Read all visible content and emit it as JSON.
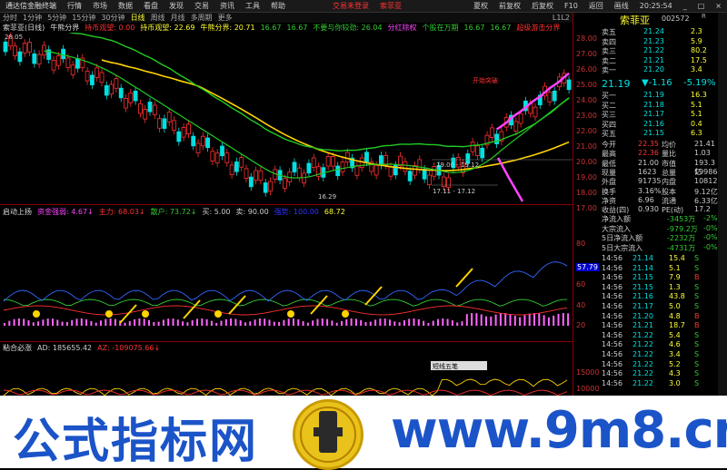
{
  "topbar": {
    "app_title": "通达信金融终端",
    "menu": [
      "行情",
      "市场",
      "数据",
      "看盘",
      "发现",
      "交易",
      "资讯",
      "工具",
      "帮助"
    ],
    "center_left": "交易未登录",
    "center_right": "索菲亚",
    "right_buttons": [
      "夏权",
      "前复权",
      "后复权",
      "F10",
      "返回",
      "画线"
    ],
    "time": "20:25:54",
    "window_controls": [
      "_",
      "□",
      "×"
    ]
  },
  "periodbar": {
    "items": [
      "分时",
      "1分钟",
      "5分钟",
      "15分钟",
      "30分钟",
      "日线",
      "周线",
      "月线",
      "多周期",
      "更多"
    ],
    "active": "日线",
    "right": "L1L2"
  },
  "chartinfo": {
    "stock": "索菲亚(日线)",
    "indicator": "牛熊分界",
    "line1": "持币观望: 0.00",
    "line2": "持币观望: 22.69",
    "line3": "牛熊分界: 20.71",
    "line4": "16.67",
    "line5": "16.67",
    "line6": "不要与你较劲: 26.04",
    "line7": "分红除权",
    "line8": "个股在万期",
    "line9": "16.67",
    "line10": "16.67",
    "line11": "超级游击分界"
  },
  "main_chart": {
    "high_label": "28.05",
    "low_label": "16.29",
    "range_label_1": "19.00 - 19.12",
    "range_label_2": "17.11 - 17.12",
    "marker_1": "开始突破",
    "y_ticks": [
      "28.00",
      "27.00",
      "26.00",
      "25.00",
      "24.00",
      "23.00",
      "22.00",
      "21.00",
      "20.00",
      "19.00",
      "18.00",
      "17.00"
    ]
  },
  "panel2": {
    "name": "启动上扬",
    "vals": [
      "资金强弱: 4.67↓",
      "主力: 68.03↓",
      "散户: 73.72↓",
      "买: 5.00",
      "卖: 90.00",
      "强势: 100.00",
      "68.72"
    ],
    "y_ticks": [
      "80",
      "60",
      "40",
      "20"
    ],
    "badge": "57.79",
    "marker_label": "启动"
  },
  "panel3": {
    "name": "粘合必涨",
    "vals": [
      "AD: 185655.42",
      "AZ: -109075.66↓"
    ],
    "y_ticks": [
      "15000",
      "10000",
      "5000"
    ],
    "popup": "短线五笔"
  },
  "quote": {
    "name": "索菲亚",
    "code": "002572",
    "code_suffix": "R",
    "price": "21.19",
    "change": "▼-1.16",
    "pct": "-5.19%",
    "asks": [
      {
        "label": "卖五",
        "price": "21.24",
        "vol": "2.3"
      },
      {
        "label": "卖四",
        "price": "21.23",
        "vol": "5.9"
      },
      {
        "label": "卖三",
        "price": "21.22",
        "vol": "80.2"
      },
      {
        "label": "卖二",
        "price": "21.21",
        "vol": "17.5"
      },
      {
        "label": "卖一",
        "price": "21.20",
        "vol": "3.4"
      }
    ],
    "bids": [
      {
        "label": "买一",
        "price": "21.19",
        "vol": "16.3"
      },
      {
        "label": "买二",
        "price": "21.18",
        "vol": "5.1"
      },
      {
        "label": "买三",
        "price": "21.17",
        "vol": "5.1"
      },
      {
        "label": "买四",
        "price": "21.16",
        "vol": "0.4"
      },
      {
        "label": "买五",
        "price": "21.15",
        "vol": "6.3"
      }
    ],
    "stats": [
      {
        "l": "今开",
        "v": "22.35",
        "l2": "均价",
        "v2": "21.41"
      },
      {
        "l": "最高",
        "v": "22.36",
        "l2": "量比",
        "v2": "1.03"
      },
      {
        "l": "最低",
        "v": "21.00",
        "l2": "市值",
        "v2": "193.3亿"
      },
      {
        "l": "现量",
        "v": "1623",
        "l2": "总量",
        "v2": "199864"
      },
      {
        "l": "外盘",
        "v": "91735",
        "l2": "内盘",
        "v2": "108129"
      },
      {
        "l": "换手",
        "v": "3.16%",
        "l2": "股本",
        "v2": "9.12亿"
      },
      {
        "l": "净资",
        "v": "6.96",
        "l2": "流通",
        "v2": "6.33亿"
      },
      {
        "l": "收益(四)",
        "v": "0.930",
        "l2": "PE(动)",
        "v2": "17.2"
      }
    ],
    "flows": [
      {
        "l": "净流入额",
        "v": "-3453万",
        "p": "-2%"
      },
      {
        "l": "大宗流入",
        "v": "-979.2万",
        "p": "-0%"
      },
      {
        "l": "5日净流入额",
        "v": "-2232万",
        "p": "-0%"
      },
      {
        "l": "5日大宗流入",
        "v": "-4731万",
        "p": "-0%"
      }
    ],
    "ticks": [
      {
        "t": "14:56",
        "p": "21.14",
        "v": "15.4",
        "s": "S"
      },
      {
        "t": "14:56",
        "p": "21.14",
        "v": "5.1",
        "s": "S"
      },
      {
        "t": "14:56",
        "p": "21.15",
        "v": "7.9",
        "s": "B"
      },
      {
        "t": "14:56",
        "p": "21.15",
        "v": "1.3",
        "s": "S"
      },
      {
        "t": "14:56",
        "p": "21.16",
        "v": "43.8",
        "s": "S"
      },
      {
        "t": "14:56",
        "p": "21.17",
        "v": "5.0",
        "s": "S"
      },
      {
        "t": "14:56",
        "p": "21.20",
        "v": "4.8",
        "s": "B"
      },
      {
        "t": "14:56",
        "p": "21.21",
        "v": "18.7",
        "s": "B"
      },
      {
        "t": "14:56",
        "p": "21.22",
        "v": "5.4",
        "s": "S"
      },
      {
        "t": "14:56",
        "p": "21.22",
        "v": "4.6",
        "s": "S"
      },
      {
        "t": "14:56",
        "p": "21.22",
        "v": "3.4",
        "s": "S"
      },
      {
        "t": "14:56",
        "p": "21.22",
        "v": "5.2",
        "s": "S"
      },
      {
        "t": "14:56",
        "p": "21.22",
        "v": "4.3",
        "s": "S"
      },
      {
        "t": "14:56",
        "p": "21.22",
        "v": "3.0",
        "s": "S"
      }
    ]
  },
  "banner": {
    "text_left": "公式指标网",
    "text_right": "www.9m8.cn",
    "logo_text": "www.9m8.cn"
  },
  "colors": {
    "up": "#ff3030",
    "down": "#00e0e0",
    "ma_yellow": "#ffd400",
    "ma_green": "#22cc22",
    "ma_magenta": "#ff44ff",
    "brand_blue": "#1b54c8"
  }
}
